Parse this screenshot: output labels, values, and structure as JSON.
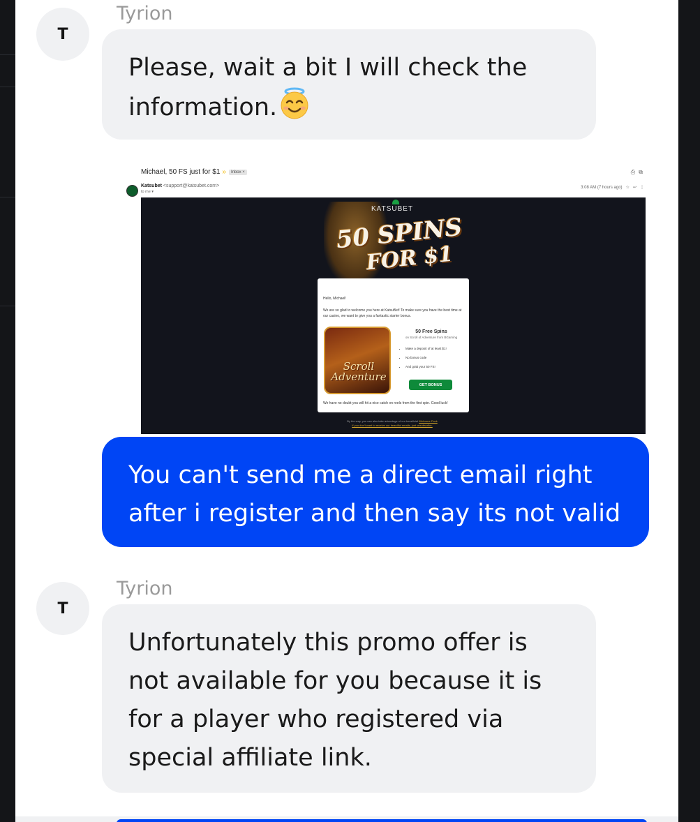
{
  "messages": [
    {
      "sender": "Tyrion",
      "avatar_initial": "T",
      "text": "Please, wait a bit I will check the information.",
      "emoji": "smiling-face-with-halo"
    },
    {
      "attachment": {
        "subject": "Michael, 50 FS just for $1",
        "inbox_label": "Inbox ×",
        "from_name": "Katsubet",
        "from_addr": "<support@katsubet.com>",
        "to": "to me ▾",
        "time": "3:08 AM (7 hours ago)",
        "brand": "KATSUBET",
        "headline_line1": "50 SPINS",
        "headline_line2": "FOR $1",
        "greeting": "Hello, Michael!",
        "welcome": "We are so glad to welcome you here at KatsuBet! To make sure you have the best time at our casino, we want to give you a fantastic starter bonus.",
        "game_name": "Scroll Adventure",
        "spins_title": "50 Free Spins",
        "spins_sub": "on Scroll of Adventure from BGaming",
        "bullets": [
          "Make a deposit of at least $1!",
          "No bonus code",
          "And grab your 50 FS!"
        ],
        "cta": "GET BONUS",
        "closing": "We have no doubt you will hit a nice catch on reels from the first spin. Good luck!",
        "footnote_1": "By the way, you can also take advantage of our beneficial",
        "footnote_link": "Welcome Pack",
        "footnote_2": "If you don't want to receive our beautiful emails, just unsubscribe."
      }
    },
    {
      "direction": "outgoing",
      "text": "You can't send me a direct email right after i register and then say its not valid"
    },
    {
      "sender": "Tyrion",
      "avatar_initial": "T",
      "text": "Unfortunately this promo offer is not available for you because it is for a player who registered via special affiliate link."
    }
  ],
  "colors": {
    "incoming_bubble": "#f0f1f3",
    "outgoing_bubble": "#0045f5",
    "sender_name": "#9a9a9a",
    "email_banner": "#12141c",
    "cta_green": "#0e8a3a"
  }
}
